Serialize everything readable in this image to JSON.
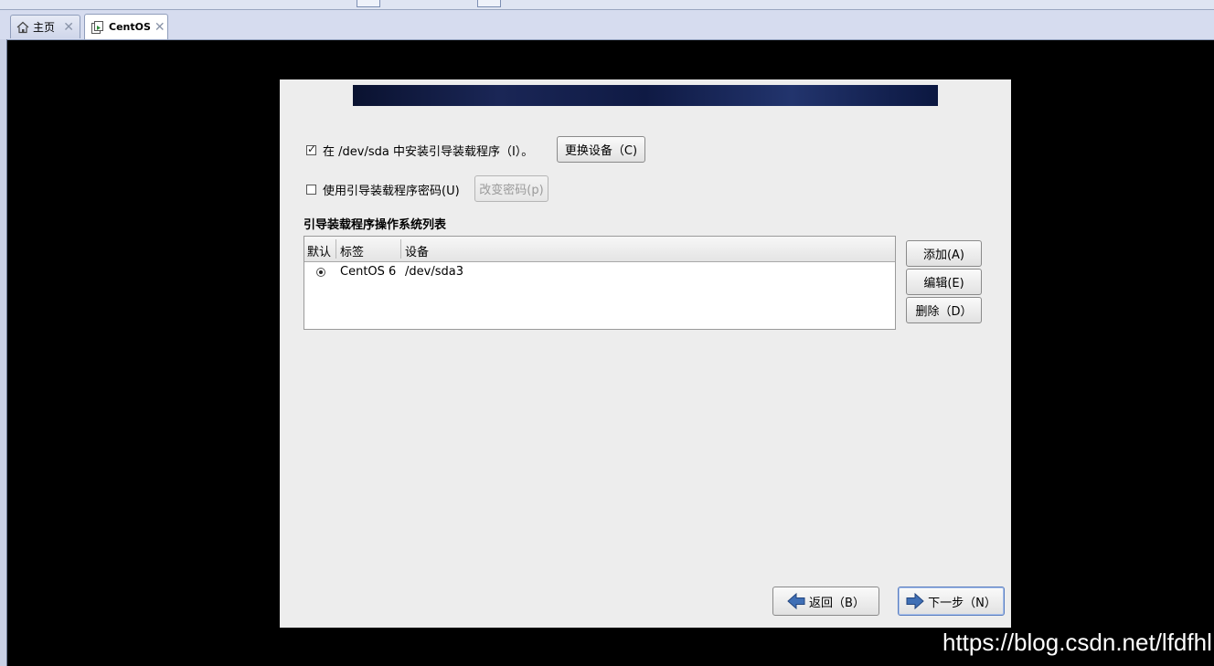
{
  "host": {
    "tabs": [
      {
        "label": "主页",
        "icon": "home-icon",
        "active": false
      },
      {
        "label": "CentOS",
        "icon": "vm-icon",
        "active": true
      }
    ],
    "close_glyph": "✕"
  },
  "installer": {
    "install_bootloader": {
      "label": "在 /dev/sda 中安装引导装载程序（I）。",
      "checked": true
    },
    "change_device_button": "更换设备（C)",
    "use_password": {
      "label": "使用引导装载程序密码(U)",
      "checked": false
    },
    "change_password_button": "改变密码(p)",
    "os_list_title": "引导装载程序操作系统列表",
    "columns": [
      "默认",
      "标签",
      "设备"
    ],
    "rows": [
      {
        "default": true,
        "label": "CentOS 6",
        "device": "/dev/sda3"
      }
    ],
    "add_button": "添加(A)",
    "edit_button": "编辑(E)",
    "delete_button": "删除（D）",
    "back_button": "返回（B）",
    "next_button": "下一步（N）"
  },
  "watermark": "https://blog.csdn.net/lfdfhl",
  "colors": {
    "banner": "#0f1a44",
    "dialog_bg": "#ededed",
    "arrow": "#3f6fb5"
  }
}
